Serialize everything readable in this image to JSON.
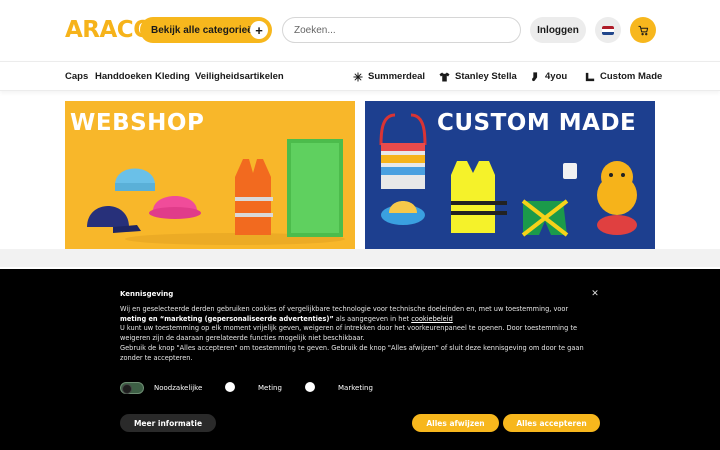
{
  "header": {
    "logo_text": "ARACO",
    "categories_button": "Bekijk alle categorieën",
    "search_placeholder": "Zoeken...",
    "login_button": "Inloggen"
  },
  "nav": {
    "left_items": [
      "Caps",
      "Handdoeken",
      "Kleding",
      "Veiligheidsartikelen"
    ],
    "right_items": [
      {
        "label": "Summerdeal",
        "icon": "snowflake-icon"
      },
      {
        "label": "Stanley Stella",
        "icon": "tshirt-icon"
      },
      {
        "label": "4you",
        "icon": "sock-icon"
      },
      {
        "label": "Custom Made",
        "icon": "ruler-icon"
      }
    ]
  },
  "banners": {
    "left_title": "WEBSHOP",
    "right_title": "CUSTOM MADE"
  },
  "cookie": {
    "title": "Kennisgeving",
    "text_1a": "Wij en geselecteerde derden gebruiken cookies of vergelijkbare technologie voor technische doeleinden en, met uw toestemming, voor ",
    "text_1b": "meting en “marketing (gepersonaliseerde advertenties)”",
    "text_1c": " als aangegeven in het ",
    "text_1d": "cookiebeleid",
    "text_2": "U kunt uw toestemming op elk moment vrijelijk geven, weigeren of intrekken door het voorkeurenpaneel te openen. Door toestemming te weigeren zijn de daaraan gerelateerde functies mogelijk niet beschikbaar.",
    "text_3": "Gebruik de knop \"Alles accepteren\" om toestemming te geven. Gebruik de knop \"Alles afwijzen\" of sluit deze kennisgeving om door te gaan zonder te accepteren.",
    "opt_necessary": "Noodzakelijke",
    "opt_measurement": "Meting",
    "opt_marketing": "Marketing",
    "btn_info": "Meer informatie",
    "btn_reject": "Alles afwijzen",
    "btn_accept": "Alles accepteren"
  },
  "colors": {
    "brand_yellow": "#f7b71d",
    "custom_blue": "#1d3f8f"
  }
}
